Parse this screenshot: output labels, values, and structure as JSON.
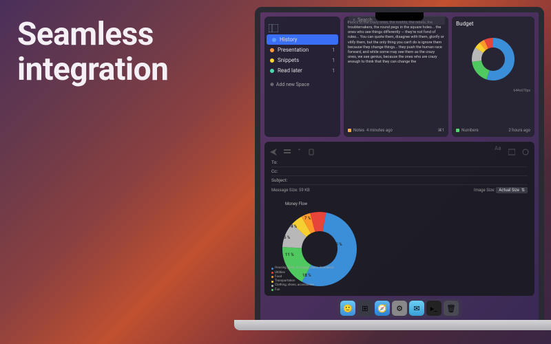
{
  "headline": {
    "line1": "Seamless",
    "line2": "integration"
  },
  "search": {
    "placeholder": "Search"
  },
  "sidebar": {
    "items": [
      {
        "label": "History",
        "color": "#5a9fff",
        "count": ""
      },
      {
        "label": "Presentation",
        "color": "#ff9a3a",
        "count": "1"
      },
      {
        "label": "Snippets",
        "color": "#ffd43a",
        "count": "1"
      },
      {
        "label": "Read later",
        "color": "#4fd8b0",
        "count": "1"
      }
    ],
    "add_label": "Add new Space"
  },
  "cards": {
    "notes": {
      "text": "Here's to the crazy ones, the misfits, the rebels, the troublemakers, the round pegs in the square holes... the ones who see things differently — they're not fond of rules... You can quote them, disagree with them, glorify or vilify them, but the only thing you can't do is ignore them because they change things... they push the human race forward, and while some may see them as the crazy ones, we see genius, because the ones who are crazy enough to think that they can change the",
      "app": "Notes",
      "app_color": "#ffb03a",
      "time": "4 minutes ago",
      "shortcut": "⌘1"
    },
    "budget": {
      "title": "Budget",
      "dims": "644x670px",
      "app": "Numbers",
      "app_color": "#4fd870",
      "time": "2 hours ago"
    }
  },
  "mail": {
    "to_label": "To:",
    "cc_label": "Cc:",
    "subject_label": "Subject:",
    "size_label": "Message Size: 59 KB",
    "image_size_label": "Image Size:",
    "image_size_value": "Actual Size",
    "chart_title": "Money Flow"
  },
  "chart_data": {
    "type": "pie",
    "title": "Money Flow",
    "series": [
      {
        "name": "Housing (Rent, mortgage, taxes, insurance)",
        "value": 55,
        "color": "#3a8fd8"
      },
      {
        "name": "Utilities",
        "value": 7,
        "color": "#e8453a"
      },
      {
        "name": "Food",
        "value": 4,
        "color": "#ff9a2a"
      },
      {
        "name": "Transportation",
        "value": 5,
        "color": "#f5d030"
      },
      {
        "name": "Clothing, shoes, accessories",
        "value": 11,
        "color": "#b8b8b8"
      },
      {
        "name": "Fun",
        "value": 18,
        "color": "#4fc860"
      }
    ]
  },
  "dock": {
    "icons": [
      "finder",
      "launchpad",
      "safari",
      "settings",
      "mail",
      "terminal",
      "trash"
    ]
  }
}
